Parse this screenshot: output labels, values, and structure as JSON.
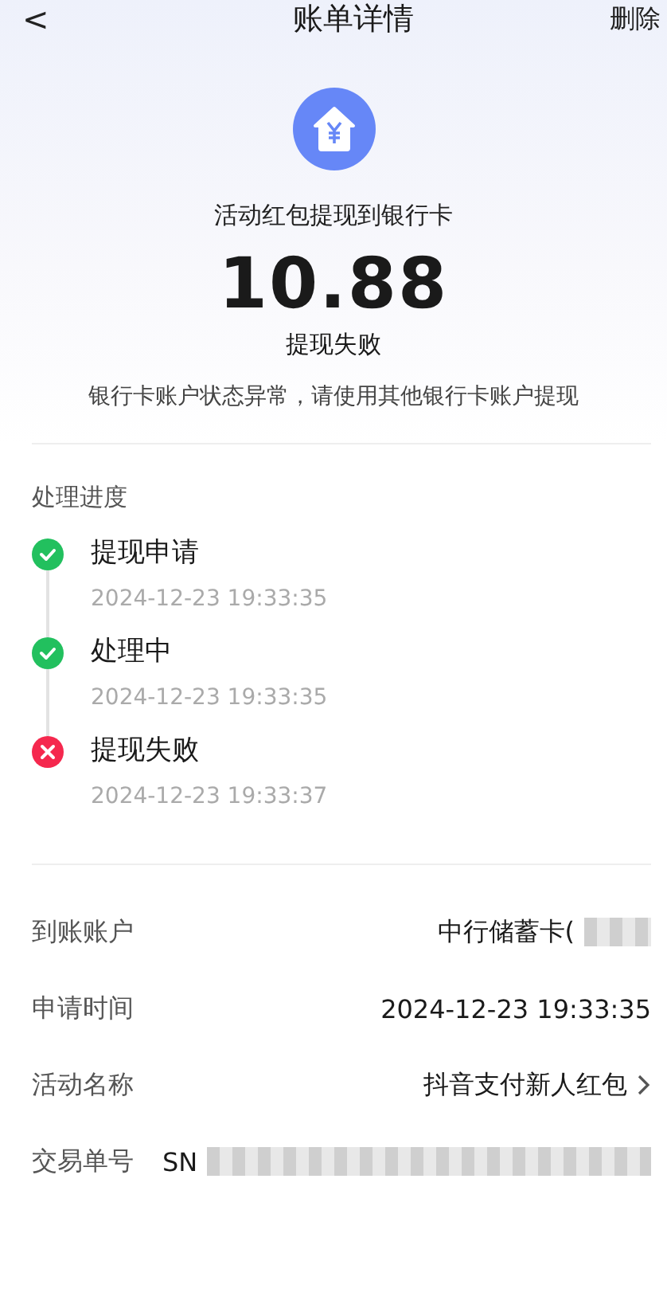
{
  "header": {
    "back": "<",
    "title": "账单详情",
    "action": "删除"
  },
  "summary": {
    "title": "活动红包提现到银行卡",
    "amount": "10.88",
    "status": "提现失败",
    "message": "银行卡账户状态异常，请使用其他银行卡账户提现"
  },
  "progress": {
    "title": "处理进度",
    "steps": [
      {
        "label": "提现申请",
        "time": "2024-12-23 19:33:35",
        "kind": "done"
      },
      {
        "label": "处理中",
        "time": "2024-12-23 19:33:35",
        "kind": "done"
      },
      {
        "label": "提现失败",
        "time": "2024-12-23 19:33:37",
        "kind": "failed"
      }
    ]
  },
  "details": [
    {
      "label": "到账账户",
      "value": "中行储蓄卡(",
      "redacted": true,
      "link": false
    },
    {
      "label": "申请时间",
      "value": "2024-12-23 19:33:35",
      "redacted": false,
      "link": false
    },
    {
      "label": "活动名称",
      "value": "抖音支付新人红包",
      "redacted": false,
      "link": true
    },
    {
      "label": "交易单号",
      "value": "SN",
      "redacted": true,
      "link": false
    }
  ]
}
